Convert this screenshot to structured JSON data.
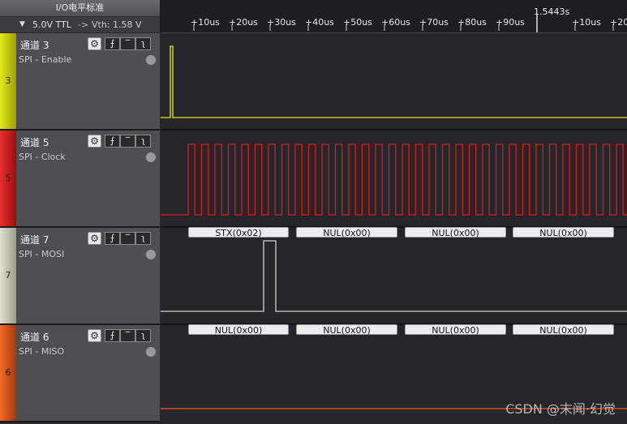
{
  "io_header": {
    "title": "I/O电平标准",
    "voltage": "5.0V TTL",
    "separator": "->",
    "vth": "Vth: 1.58 V"
  },
  "ruler": {
    "ticks": [
      "+10us",
      "+20us",
      "+30us",
      "+40us",
      "+50us",
      "+60us",
      "+70us",
      "+80us",
      "+90us",
      "+10us",
      "+20"
    ],
    "marker_label": "1.5443s"
  },
  "channels": [
    {
      "index": "3",
      "name": "通道 3",
      "subtitle": "SPI - Enable",
      "color": "#d8dc10"
    },
    {
      "index": "5",
      "name": "通道 5",
      "subtitle": "SPI - Clock",
      "color": "#d82020"
    },
    {
      "index": "7",
      "name": "通道 7",
      "subtitle": "SPI - MOSI",
      "color": "#d8d8c8"
    },
    {
      "index": "6",
      "name": "通道 6",
      "subtitle": "SPI - MISO",
      "color": "#e85a20"
    }
  ],
  "mosi_decoded": [
    "STX(0x02)",
    "NUL(0x00)",
    "NUL(0x00)",
    "NUL(0x00)"
  ],
  "miso_decoded": [
    "NUL(0x00)",
    "NUL(0x00)",
    "NUL(0x00)",
    "NUL(0x00)"
  ],
  "watermark": "CSDN @末闻·幻觉"
}
